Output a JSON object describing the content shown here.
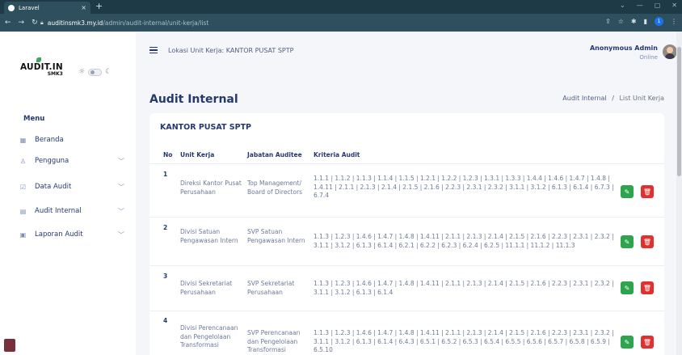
{
  "browser": {
    "tab_title": "Laravel",
    "tab_close": "×",
    "new_tab": "+",
    "url_host": "auditinsmk3.my.id",
    "url_path": "/admin/audit-internal/unit-kerja/list",
    "profile_initial": "1"
  },
  "sidebar": {
    "logo_text": "AUDIT.IN",
    "logo_sub": "SMK3",
    "menu_title": "Menu",
    "items": [
      {
        "label": "Beranda",
        "icon": "grid-icon",
        "glyph": "▦",
        "has_chevron": false
      },
      {
        "label": "Pengguna",
        "icon": "user-icon",
        "glyph": "♙",
        "has_chevron": true
      },
      {
        "label": "Data Audit",
        "icon": "checkbox-icon",
        "glyph": "☑",
        "has_chevron": true
      },
      {
        "label": "Audit Internal",
        "icon": "building-icon",
        "glyph": "▤",
        "has_chevron": true
      },
      {
        "label": "Laporan Audit",
        "icon": "report-icon",
        "glyph": "▣",
        "has_chevron": true
      }
    ],
    "chevron": "﹀"
  },
  "header": {
    "location": "Lokasi Unit Kerja: KANTOR PUSAT SPTP",
    "user_name": "Anonymous Admin",
    "user_status": "Online"
  },
  "page": {
    "title": "Audit Internal",
    "breadcrumb_parent": "Audit Internal",
    "breadcrumb_sep": "/",
    "breadcrumb_current": "List Unit Kerja"
  },
  "card": {
    "title": "KANTOR PUSAT SPTP",
    "columns": [
      "No",
      "Unit Kerja",
      "Jabatan Auditee",
      "Kriteria Audit"
    ],
    "rows": [
      {
        "no": "1",
        "unit_kerja": "Direksi Kantor Pusat Perusahaan",
        "jabatan": "Top Management/ Board of Directors",
        "kriteria": "1.1.1 | 1.1.2 | 1.1.3 | 1.1.4 | 1.1.5 | 1.2.1 | 1.2.2 | 1.2.3 | 1.3.1 | 1.3.3 | 1.4.4 | 1.4.6 | 1.4.7 | 1.4.8 | 1.4.11 | 2.1.1 | 2.1.3 | 2.1.4 | 2.1.5 | 2.1.6 | 2.2.3 | 2.3.1 | 2.3.2 | 3.1.1 | 3.1.2 | 6.1.3 | 6.1.4 | 6.7.3 | 6.7.4"
      },
      {
        "no": "2",
        "unit_kerja": "Divisi Satuan Pengawasan Intern",
        "jabatan": "SVP Satuan Pengawasan Intern",
        "kriteria": "1.1.3 | 1.2.3 | 1.4.6 | 1.4.7 | 1.4.8 | 1.4.11 | 2.1.1 | 2.1.3 | 2.1.4 | 2.1.5 | 2.1.6 | 2.2.3 | 2.3.1 | 2.3.2 | 3.1.1 | 3.1.2 | 6.1.3 | 6.1.4 | 6.2.1 | 6.2.2 | 6.2.3 | 6.2.4 | 6.2.5 | 11.1.1 | 11.1.2 | 11.1.3"
      },
      {
        "no": "3",
        "unit_kerja": "Divisi Sekretariat Perusahaan",
        "jabatan": "SVP Sekretariat Perusahaan",
        "kriteria": "1.1.3 | 1.2.3 | 1.4.6 | 1.4.7 | 1.4.8 | 1.4.11 | 2.1.1 | 2.1.3 | 2.1.4 | 2.1.5 | 2.1.6 | 2.2.3 | 2.3.1 | 2.3.2 | 3.1.1 | 3.1.2 | 6.1.3 | 6.1.4"
      },
      {
        "no": "4",
        "unit_kerja": "Divisi Perencanaan dan Pengelolaan Transformasi",
        "jabatan": "SVP Perencanaan dan Pengelolaan Transformasi",
        "kriteria": "1.1.3 | 1.2.3 | 1.4.6 | 1.4.7 | 1.4.8 | 1.4.11 | 2.1.1 | 2.1.3 | 2.1.4 | 2.1.5 | 2.1.6 | 2.2.3 | 2.3.1 | 2.3.2 | 3.1.1 | 3.1.2 | 6.1.3 | 6.1.4 | 6.4.3 | 6.5.1 | 6.5.2 | 6.5.3 | 6.5.4 | 6.5.5 | 6.5.6 | 6.5.7 | 6.5.8 | 6.5.9 | 6.5.10"
      }
    ]
  },
  "colors": {
    "edit_button": "#2ea44f",
    "delete_button": "#e03030",
    "primary_text": "#25396f"
  }
}
